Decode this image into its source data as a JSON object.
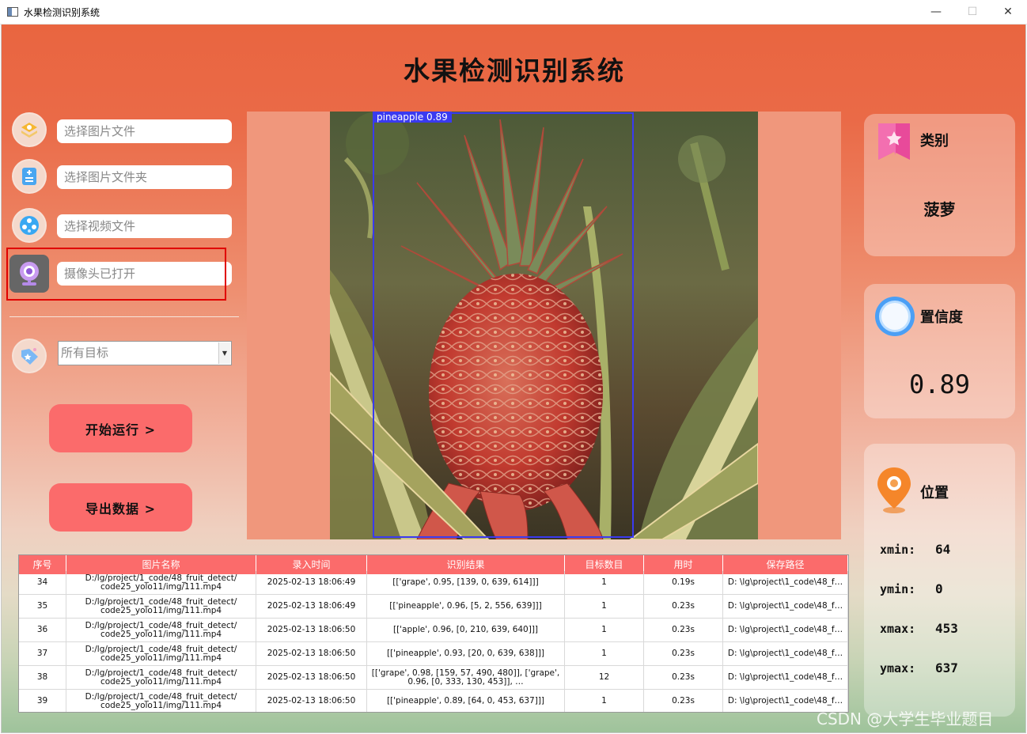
{
  "window": {
    "title": "水果检测识别系统",
    "minimize": "—",
    "maximize": "☐",
    "close": "✕"
  },
  "header": {
    "title": "水果检测识别系统"
  },
  "left_panel": {
    "inputs": [
      {
        "placeholder": "选择图片文件",
        "icon": "image-file-icon"
      },
      {
        "placeholder": "选择图片文件夹",
        "icon": "folder-icon"
      },
      {
        "placeholder": "选择视频文件",
        "icon": "video-icon"
      },
      {
        "placeholder": "摄像头已打开",
        "icon": "camera-icon"
      }
    ],
    "target_select": {
      "value": "所有目标",
      "icon": "tag-icon"
    },
    "start_button": "开始运行 >",
    "export_button": "导出数据 >"
  },
  "detection": {
    "label": "pineapple 0.89",
    "box_color": "#3a3af0"
  },
  "result_cards": {
    "category": {
      "label": "类别",
      "value": "菠萝"
    },
    "confidence": {
      "label": "置信度",
      "value": "0.89"
    },
    "position": {
      "label": "位置",
      "xmin_label": "xmin:",
      "xmin": "64",
      "ymin_label": "ymin:",
      "ymin": "0",
      "xmax_label": "xmax:",
      "xmax": "453",
      "ymax_label": "ymax:",
      "ymax": "637"
    }
  },
  "table": {
    "headers": [
      "序号",
      "图片名称",
      "录入时间",
      "识别结果",
      "目标数目",
      "用时",
      "保存路径"
    ],
    "rows": [
      [
        "34",
        "D:/lg/project/1_code/48_fruit_detect/ code25_yolo11/img/111.mp4",
        "2025-02-13 18:06:49",
        "[['grape', 0.95, [139, 0, 639, 614]]]",
        "1",
        "0.19s",
        "D: \\lg\\project\\1_code\\48_f…"
      ],
      [
        "35",
        "D:/lg/project/1_code/48_fruit_detect/ code25_yolo11/img/111.mp4",
        "2025-02-13 18:06:49",
        "[['pineapple', 0.96, [5, 2, 556, 639]]]",
        "1",
        "0.23s",
        "D: \\lg\\project\\1_code\\48_f…"
      ],
      [
        "36",
        "D:/lg/project/1_code/48_fruit_detect/ code25_yolo11/img/111.mp4",
        "2025-02-13 18:06:50",
        "[['apple', 0.96, [0, 210, 639, 640]]]",
        "1",
        "0.23s",
        "D: \\lg\\project\\1_code\\48_f…"
      ],
      [
        "37",
        "D:/lg/project/1_code/48_fruit_detect/ code25_yolo11/img/111.mp4",
        "2025-02-13 18:06:50",
        "[['pineapple', 0.93, [20, 0, 639, 638]]]",
        "1",
        "0.23s",
        "D: \\lg\\project\\1_code\\48_f…"
      ],
      [
        "38",
        "D:/lg/project/1_code/48_fruit_detect/ code25_yolo11/img/111.mp4",
        "2025-02-13 18:06:50",
        "[['grape', 0.98, [159, 57, 490, 480]], ['grape', 0.96, [0, 333, 130, 453]], …",
        "12",
        "0.23s",
        "D: \\lg\\project\\1_code\\48_f…"
      ],
      [
        "39",
        "D:/lg/project/1_code/48_fruit_detect/ code25_yolo11/img/111.mp4",
        "2025-02-13 18:06:50",
        "[['pineapple', 0.89, [64, 0, 453, 637]]]",
        "1",
        "0.23s",
        "D: \\lg\\project\\1_code\\48_f…"
      ]
    ]
  },
  "watermark": "CSDN @大学生毕业题目"
}
